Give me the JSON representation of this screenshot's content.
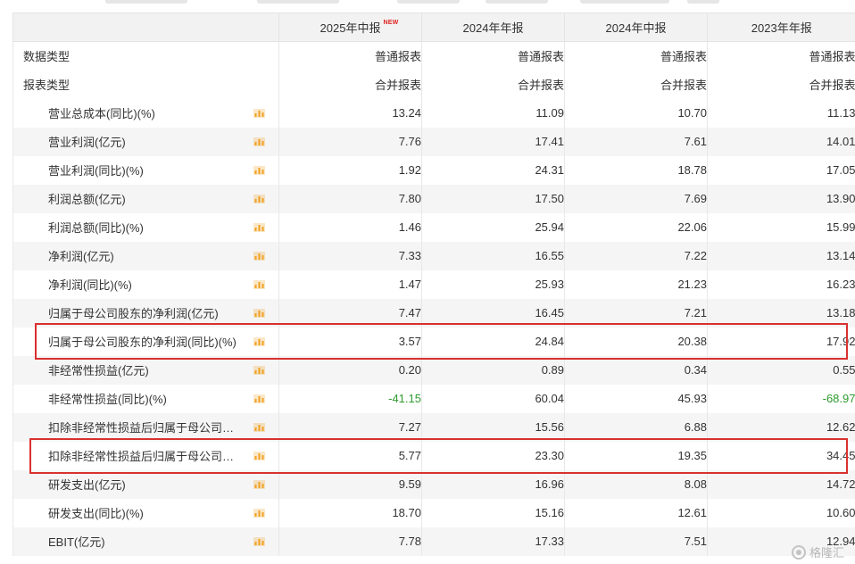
{
  "table": {
    "columns": [
      {
        "label": "2025年中报",
        "badge": "NEW"
      },
      {
        "label": "2024年年报"
      },
      {
        "label": "2024年中报"
      },
      {
        "label": "2023年年报"
      }
    ],
    "type_rows": [
      {
        "label": "数据类型",
        "values": [
          "普通报表",
          "普通报表",
          "普通报表",
          "普通报表"
        ]
      },
      {
        "label": "报表类型",
        "values": [
          "合并报表",
          "合并报表",
          "合并报表",
          "合并报表"
        ]
      }
    ],
    "metric_rows": [
      {
        "label": "营业总成本(同比)(%)",
        "values": [
          "13.24",
          "11.09",
          "10.70",
          "11.13"
        ]
      },
      {
        "label": "营业利润(亿元)",
        "values": [
          "7.76",
          "17.41",
          "7.61",
          "14.01"
        ]
      },
      {
        "label": "营业利润(同比)(%)",
        "values": [
          "1.92",
          "24.31",
          "18.78",
          "17.05"
        ]
      },
      {
        "label": "利润总额(亿元)",
        "values": [
          "7.80",
          "17.50",
          "7.69",
          "13.90"
        ]
      },
      {
        "label": "利润总额(同比)(%)",
        "values": [
          "1.46",
          "25.94",
          "22.06",
          "15.99"
        ]
      },
      {
        "label": "净利润(亿元)",
        "values": [
          "7.33",
          "16.55",
          "7.22",
          "13.14"
        ]
      },
      {
        "label": "净利润(同比)(%)",
        "values": [
          "1.47",
          "25.93",
          "21.23",
          "16.23"
        ]
      },
      {
        "label": "归属于母公司股东的净利润(亿元)",
        "values": [
          "7.47",
          "16.45",
          "7.21",
          "13.18"
        ]
      },
      {
        "label": "归属于母公司股东的净利润(同比)(%)",
        "values": [
          "3.57",
          "24.84",
          "20.38",
          "17.92"
        ]
      },
      {
        "label": "非经常性损益(亿元)",
        "values": [
          "0.20",
          "0.89",
          "0.34",
          "0.55"
        ]
      },
      {
        "label": "非经常性损益(同比)(%)",
        "values": [
          "-41.15",
          "60.04",
          "45.93",
          "-68.97"
        ]
      },
      {
        "label": "扣除非经常性损益后归属于母公司…",
        "values": [
          "7.27",
          "15.56",
          "6.88",
          "12.62"
        ]
      },
      {
        "label": "扣除非经常性损益后归属于母公司…",
        "values": [
          "5.77",
          "23.30",
          "19.35",
          "34.45"
        ]
      },
      {
        "label": "研发支出(亿元)",
        "values": [
          "9.59",
          "16.96",
          "8.08",
          "14.72"
        ]
      },
      {
        "label": "研发支出(同比)(%)",
        "values": [
          "18.70",
          "15.16",
          "12.61",
          "10.60"
        ]
      },
      {
        "label": "EBIT(亿元)",
        "values": [
          "7.78",
          "17.33",
          "7.51",
          "12.94"
        ]
      }
    ]
  },
  "colors": {
    "highlight": "#d9302f",
    "negative": "#2e9a2e",
    "chart_icon": "#f0a020",
    "new_badge": "#e02020"
  },
  "icons": {
    "metric_row": "bar-chart-icon"
  },
  "watermark": {
    "text": "格隆汇"
  }
}
